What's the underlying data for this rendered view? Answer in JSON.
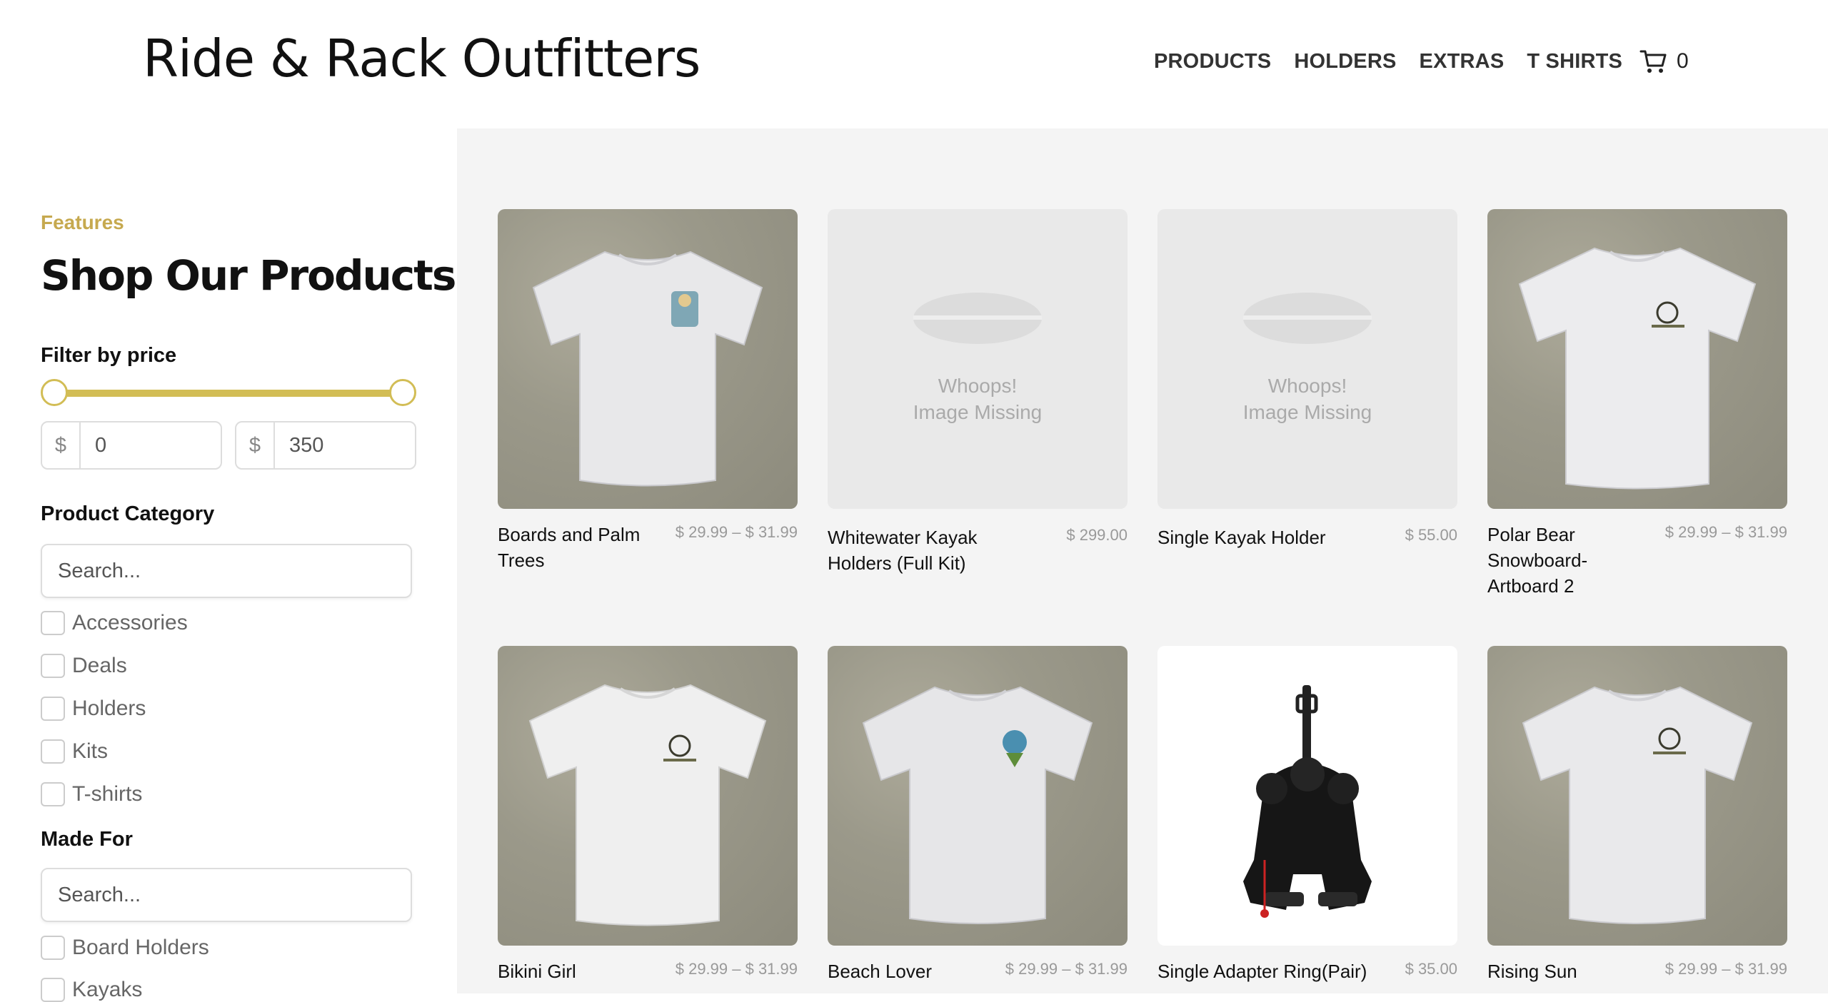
{
  "header": {
    "logo": "Ride & Rack Outfitters",
    "nav": [
      "PRODUCTS",
      "HOLDERS",
      "EXTRAS",
      "T SHIRTS"
    ],
    "cart_count": "0"
  },
  "sidebar": {
    "eyebrow": "Features",
    "title": "Shop Our Products",
    "price_filter": {
      "label": "Filter by price",
      "currency": "$",
      "min": "0",
      "max": "350"
    },
    "category": {
      "label": "Product Category",
      "placeholder": "Search...",
      "options": [
        "Accessories",
        "Deals",
        "Holders",
        "Kits",
        "T-shirts"
      ]
    },
    "made_for": {
      "label": "Made For",
      "placeholder": "Search...",
      "options": [
        "Board Holders",
        "Kayaks"
      ]
    }
  },
  "products": [
    {
      "name": "Boards and Palm Trees",
      "price": "$ 29.99 – $ 31.99",
      "image": "tshirt"
    },
    {
      "name": "Whitewater Kayak Holders (Full Kit)",
      "price": "$ 299.00",
      "image": "missing"
    },
    {
      "name": "Single Kayak Holder",
      "price": "$ 55.00",
      "image": "missing"
    },
    {
      "name": "Polar Bear Snowboard-Artboard 2",
      "price": "$ 29.99 – $ 31.99",
      "image": "tshirt"
    },
    {
      "name": "Bikini Girl",
      "price": "$ 29.99 – $ 31.99",
      "image": "tshirt"
    },
    {
      "name": "Beach Lover",
      "price": "$ 29.99 – $ 31.99",
      "image": "tshirt"
    },
    {
      "name": "Single Adapter Ring(Pair)",
      "price": "$ 35.00",
      "image": "boots"
    },
    {
      "name": "Rising Sun",
      "price": "$ 29.99 – $ 31.99",
      "image": "tshirt"
    }
  ],
  "missing_image_text": [
    "Whoops!",
    "Image Missing"
  ],
  "colors": {
    "accent": "#c6a94f",
    "slider": "#d2bd55",
    "main_bg": "#f4f4f4"
  }
}
